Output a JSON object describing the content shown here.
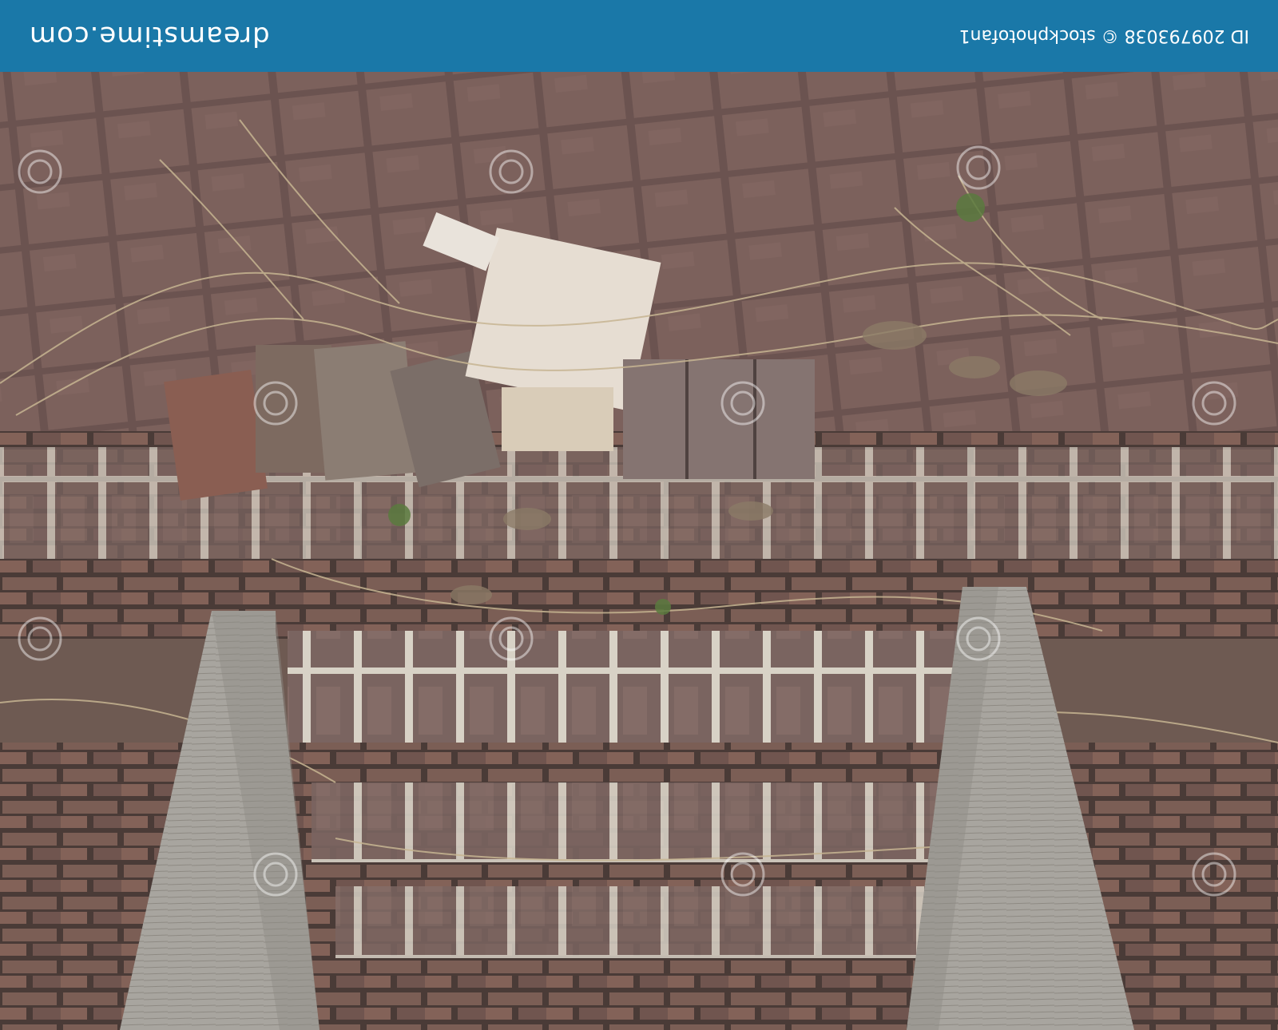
{
  "banner": {
    "brand": "dreamstime.com",
    "credit": "ID 209793038 © stockphotofan1"
  },
  "colors": {
    "banner": "#1a78a8",
    "brick": "#7a5f58",
    "mortar": "#3a3230",
    "wood": "#a7a49e",
    "dry_grass": "#c7b592"
  },
  "watermark": {
    "icon": "spiral-icon"
  }
}
